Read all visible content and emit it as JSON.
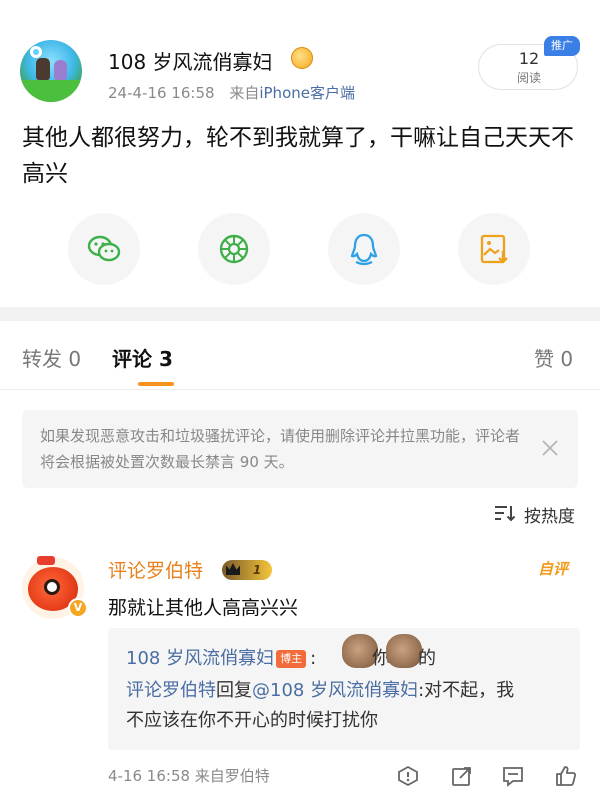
{
  "post": {
    "username": "108 岁风流俏寡妇",
    "meta_date": "24-4-16 16:58",
    "meta_from": "来自",
    "meta_source": "iPhone客户端",
    "read_count": "12",
    "read_label": "阅读",
    "promo_tag": "推广",
    "text": "其他人都很努力，轮不到我就算了，干嘛让自己天天不高兴"
  },
  "share": [
    {
      "icon": "wechat-icon",
      "color": "#3fb049"
    },
    {
      "icon": "moments-icon",
      "color": "#3fb049"
    },
    {
      "icon": "qq-icon",
      "color": "#2ea0e6"
    },
    {
      "icon": "save-image-icon",
      "color": "#f0a11c"
    }
  ],
  "tabs": {
    "repost": "转发 0",
    "comment": "评论 3",
    "like": "赞 0"
  },
  "notice": {
    "text": "如果发现恶意攻击和垃圾骚扰评论，请使用删除评论并拉黑功能，评论者将会根据被处置次数最长禁言 90 天。"
  },
  "sort": {
    "label": "按热度"
  },
  "comment": {
    "name": "评论罗伯特",
    "level": "1",
    "v_badge": "V",
    "hot_tag": "自评",
    "text": "那就让其他人高高兴兴",
    "replies": {
      "first_author": "108 岁风流俏寡妇",
      "bozhu_tag": "博主",
      "first_prefix": ":",
      "first_mid": "你",
      "first_end": "的",
      "second_author": "评论罗伯特",
      "second_verb": "回复",
      "second_target": "@108 岁风流俏寡妇",
      "second_text": ":对不起，我不应该在你不开心的时候打扰你"
    },
    "footer": "4-16 16:58  来自罗伯特"
  },
  "colors": {
    "accent_orange": "#f7931e",
    "link_blue": "#4a6ea3",
    "promo_blue": "#3a7fe6"
  }
}
